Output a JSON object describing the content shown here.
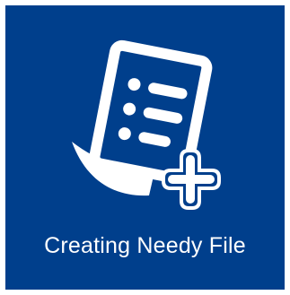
{
  "tile": {
    "label": "Creating Needy File",
    "icon": "document-add-icon",
    "background_color": "#003f8c",
    "foreground_color": "#ffffff"
  }
}
